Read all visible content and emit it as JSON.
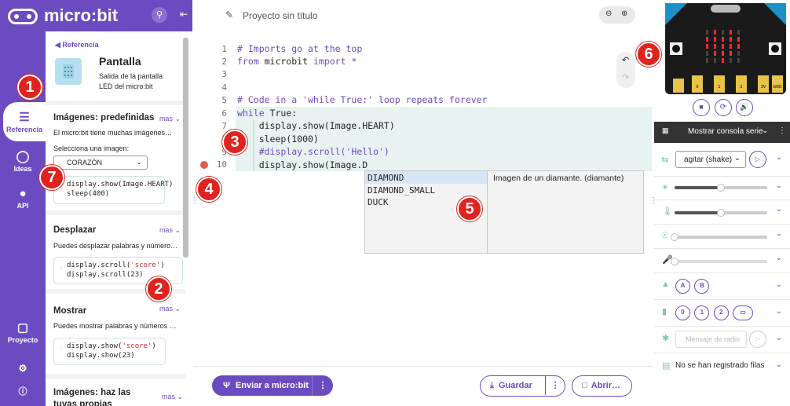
{
  "app": {
    "brand": "micro:bit",
    "project_title": "Proyecto sin título"
  },
  "nav": {
    "reference": "Referencia",
    "ideas": "Ideas",
    "api": "API",
    "project": "Proyecto"
  },
  "reference": {
    "back_link": "Referencia",
    "topic_title": "Pantalla",
    "topic_desc_1": "Salida de la pantalla",
    "topic_desc_2": "LED del micro:bit",
    "sections": [
      {
        "title": "Imágenes: predefinidas",
        "more": "mas",
        "desc": "El micro:bit tiene muchas imágenes…",
        "select_label": "Selecciona una imagen:",
        "select_value": "CORAZÓN",
        "code": [
          "display.show(Image.HEART)",
          "sleep(400)"
        ]
      },
      {
        "title": "Desplazar",
        "more": "mas",
        "desc": "Puedes desplazar palabras y número…",
        "code": [
          "display.scroll('score')",
          "display.scroll(23)"
        ]
      },
      {
        "title": "Mostrar",
        "more": "mas",
        "desc": "Puedes mostrar palabras y números …",
        "code": [
          "display.show('score')",
          "display.show(23)"
        ]
      },
      {
        "title": "Imágenes: haz las tuyas propias",
        "more": "mas"
      }
    ]
  },
  "editor": {
    "lines": [
      {
        "n": "1",
        "text": "# Imports go at the top"
      },
      {
        "n": "2",
        "text": "from microbit import *"
      },
      {
        "n": "3",
        "text": ""
      },
      {
        "n": "4",
        "text": ""
      },
      {
        "n": "5",
        "text": "# Code in a 'while True:' loop repeats forever"
      },
      {
        "n": "6",
        "text": "while True:"
      },
      {
        "n": "7",
        "text": "    display.show(Image.HEART)"
      },
      {
        "n": "8",
        "text": "    sleep(1000)"
      },
      {
        "n": "9",
        "text": "    #display.scroll('Hello')"
      },
      {
        "n": "10",
        "text": "    display.show(Image.D"
      }
    ],
    "autocomplete": {
      "options": [
        "DIAMOND",
        "DIAMOND_SMALL",
        "DUCK"
      ],
      "doc": "Imagen de un diamante. (diamante)"
    },
    "send_button": "Enviar a micro:bit",
    "save_button": "Guardar",
    "open_button": "Abrir…"
  },
  "simulator": {
    "console_label": "Mostrar consola serie",
    "gesture_value": "agitar (shake)",
    "light_level": 0.5,
    "temperature_level": 0.5,
    "compass_level": 0.0,
    "sound_level": 0.0,
    "buttons_ab": [
      "A",
      "B"
    ],
    "pins": [
      "0",
      "1",
      "2"
    ],
    "radio_placeholder": "Mensaje de radio",
    "data_log": "No se han registrado filas",
    "board_pins": [
      "0",
      "1",
      "2",
      "3V",
      "GND"
    ]
  },
  "callouts": [
    "1",
    "2",
    "3",
    "4",
    "5",
    "6",
    "7"
  ],
  "colors": {
    "brand": "#6c4bc1",
    "callout": "#e0231e",
    "highlight": "#e8f3f1",
    "led_on": "#ff2b2b"
  }
}
